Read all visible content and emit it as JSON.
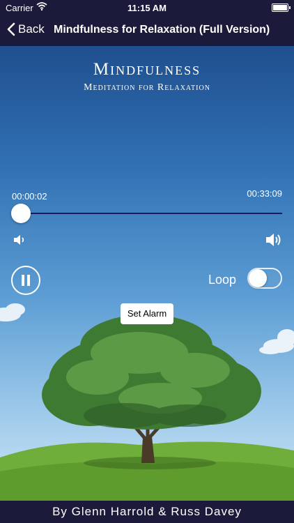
{
  "status_bar": {
    "carrier": "Carrier",
    "time": "11:15 AM"
  },
  "nav": {
    "back_label": "Back",
    "title": "Mindfulness for Relaxation (Full Version)"
  },
  "brand": {
    "title": "Mindfulness",
    "subtitle": "Meditation for Relaxation"
  },
  "player": {
    "elapsed": "00:00:02",
    "total": "00:33:09",
    "progress_fraction": 0.001,
    "state": "playing",
    "loop_label": "Loop",
    "loop_enabled": false
  },
  "alarm": {
    "button_label": "Set Alarm"
  },
  "footer": {
    "credits": "By Glenn Harrold & Russ Davey"
  },
  "colors": {
    "bar_background": "#1c1a3a",
    "sky_top": "#1f4f8e",
    "grass": "#6fae3a"
  },
  "icons": [
    "back-chevron-icon",
    "wifi-icon",
    "battery-icon",
    "volume-low-icon",
    "volume-high-icon",
    "pause-icon"
  ]
}
